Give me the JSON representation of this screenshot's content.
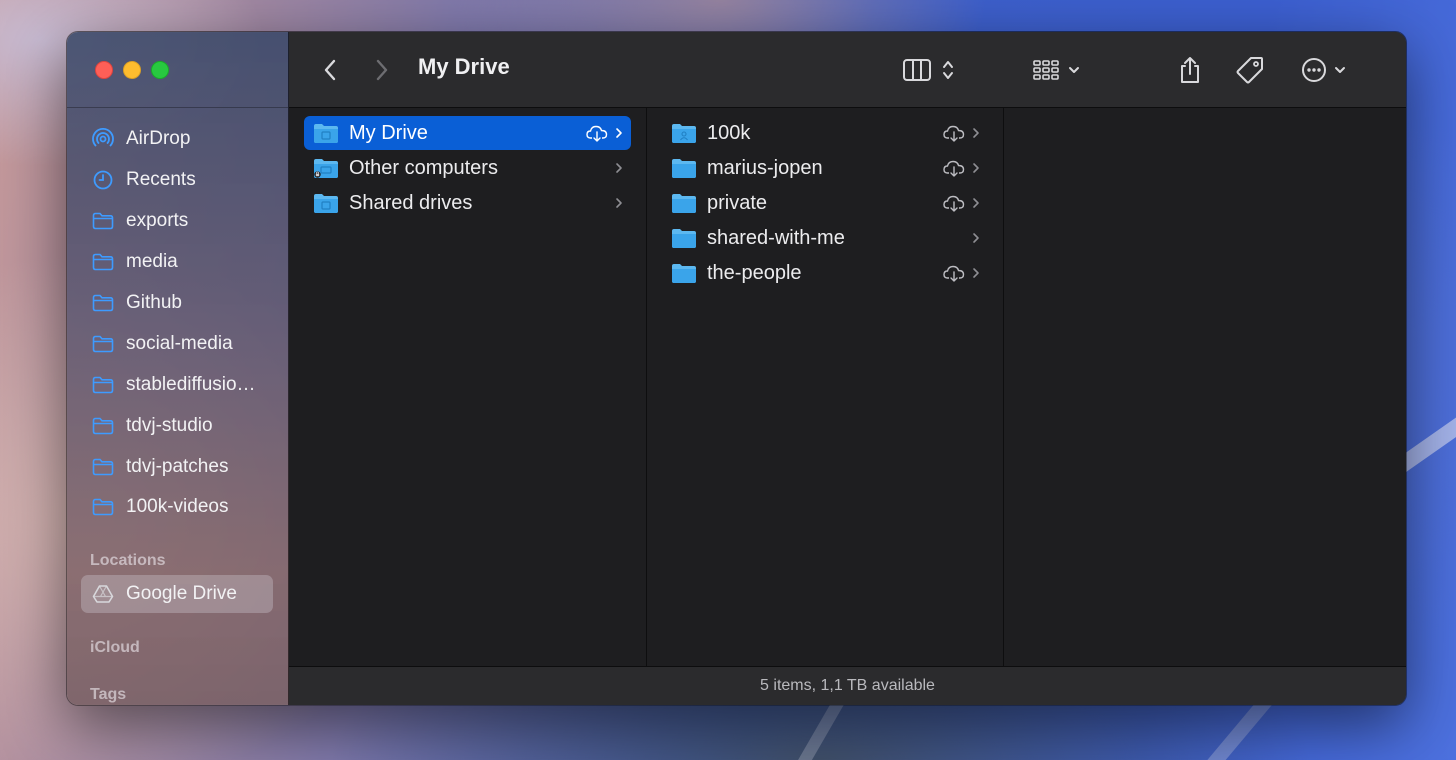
{
  "window": {
    "title": "My Drive",
    "status": "5 items, 1,1 TB available"
  },
  "sidebar": {
    "favorites": [
      {
        "label": "AirDrop",
        "icon": "airdrop-icon"
      },
      {
        "label": "Recents",
        "icon": "clock-icon"
      },
      {
        "label": "exports",
        "icon": "folder-icon"
      },
      {
        "label": "media",
        "icon": "folder-icon"
      },
      {
        "label": "Github",
        "icon": "folder-icon"
      },
      {
        "label": "social-media",
        "icon": "folder-icon"
      },
      {
        "label": "stablediffusio…",
        "icon": "folder-icon"
      },
      {
        "label": "tdvj-studio",
        "icon": "folder-icon"
      },
      {
        "label": "tdvj-patches",
        "icon": "folder-icon"
      },
      {
        "label": "100k-videos",
        "icon": "folder-icon"
      }
    ],
    "locations_header": "Locations",
    "locations": [
      {
        "label": "Google Drive",
        "icon": "google-drive-icon",
        "selected": true
      }
    ],
    "icloud_header": "iCloud",
    "tags_header": "Tags"
  },
  "columns": {
    "col1": [
      {
        "label": "My Drive",
        "icon": "drive-folder-icon",
        "selected": true,
        "cloud": true
      },
      {
        "label": "Other computers",
        "icon": "computers-folder-icon",
        "selected": false,
        "cloud": false
      },
      {
        "label": "Shared drives",
        "icon": "drive-folder-icon",
        "selected": false,
        "cloud": false
      }
    ],
    "col2": [
      {
        "label": "100k",
        "icon": "shared-folder-icon",
        "cloud": true
      },
      {
        "label": "marius-jopen",
        "icon": "folder-icon",
        "cloud": true
      },
      {
        "label": "private",
        "icon": "folder-icon",
        "cloud": true
      },
      {
        "label": "shared-with-me",
        "icon": "folder-icon",
        "cloud": false
      },
      {
        "label": "the-people",
        "icon": "folder-icon",
        "cloud": true
      }
    ]
  },
  "colors": {
    "selection": "#0a5fd6",
    "folder": "#36a8ea",
    "sidebar_icon": "#3e9bff"
  }
}
